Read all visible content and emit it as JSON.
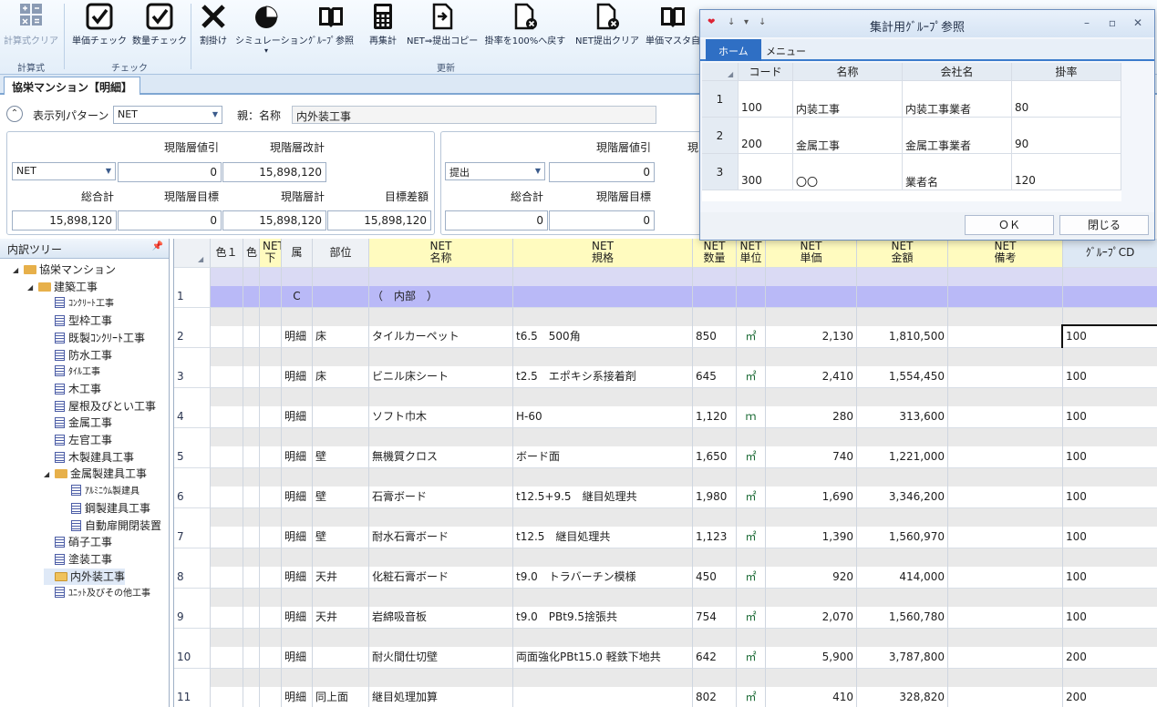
{
  "ribbon": {
    "buttons": [
      {
        "label": "計算式クリア",
        "icon": "calc-grid-icon",
        "gray": true
      },
      {
        "label": "単価チェック",
        "icon": "checkbox-icon"
      },
      {
        "label": "数量チェック",
        "icon": "checkbox-icon"
      },
      {
        "label": "割掛け",
        "icon": "x-mark-icon"
      },
      {
        "label": "シミュレーション",
        "icon": "pie-chart-icon"
      },
      {
        "label": "ｸﾞﾙｰﾌﾟ参照",
        "icon": "book-icon"
      },
      {
        "label": "再集計",
        "icon": "calculator-icon"
      },
      {
        "label": "NET⇒提出コピー",
        "icon": "doc-arrow-icon"
      },
      {
        "label": "掛率を100%へ戻す",
        "icon": "doc-clear-icon"
      },
      {
        "label": "NET提出クリア",
        "icon": "doc-clear-icon"
      },
      {
        "label": "単価マスタ自",
        "icon": "book-icon"
      }
    ],
    "groups": {
      "calc": "計算式",
      "check": "チェック",
      "update": "更新"
    }
  },
  "doc_tab": "協栄マンション【明細】",
  "filter": {
    "pattern_label": "表示列パターン",
    "pattern_value": "NET",
    "parent_label": "親：名称",
    "parent_value": "内外装工事"
  },
  "totals_left": {
    "combo": "NET",
    "labels": {
      "disc": "現階層値引",
      "revised": "現階層改計",
      "grand": "総合計",
      "target": "現階層目標",
      "sum": "現階層計",
      "diff": "目標差額"
    },
    "values": {
      "disc": "0",
      "revised": "15,898,120",
      "grand": "15,898,120",
      "target": "0",
      "sum": "15,898,120",
      "diff": "15,898,120"
    }
  },
  "totals_right": {
    "combo": "提出",
    "labels": {
      "disc": "現階層値引",
      "revised_partial": "現",
      "grand": "総合計",
      "target": "現階層目標"
    },
    "values": {
      "disc": "0",
      "grand": "0",
      "target": "0"
    }
  },
  "tree": {
    "title": "内訳ツリー",
    "pin": "ᵖ",
    "nodes": [
      {
        "label": "協栄マンション",
        "type": "folder",
        "level": 0,
        "exp": "◢"
      },
      {
        "label": "建築工事",
        "type": "folder",
        "level": 1,
        "exp": "◢"
      },
      {
        "label": "ｺﾝｸﾘｰﾄ工事",
        "type": "doc",
        "level": 2,
        "small": true
      },
      {
        "label": "型枠工事",
        "type": "doc",
        "level": 2
      },
      {
        "label": "既製ｺﾝｸﾘｰﾄ工事",
        "type": "doc",
        "level": 2
      },
      {
        "label": "防水工事",
        "type": "doc",
        "level": 2
      },
      {
        "label": "ﾀｲﾙ工事",
        "type": "doc",
        "level": 2,
        "small": true
      },
      {
        "label": "木工事",
        "type": "doc",
        "level": 2
      },
      {
        "label": "屋根及びとい工事",
        "type": "doc",
        "level": 2
      },
      {
        "label": "金属工事",
        "type": "doc",
        "level": 2
      },
      {
        "label": "左官工事",
        "type": "doc",
        "level": 2
      },
      {
        "label": "木製建具工事",
        "type": "doc",
        "level": 2
      },
      {
        "label": "金属製建具工事",
        "type": "folder",
        "level": 2,
        "exp": "◢"
      },
      {
        "label": "ｱﾙﾐﾆｳﾑ製建具",
        "type": "doc",
        "level": 3,
        "small": true
      },
      {
        "label": "鋼製建具工事",
        "type": "doc",
        "level": 3
      },
      {
        "label": "自動扉開閉装置",
        "type": "doc",
        "level": 3
      },
      {
        "label": "硝子工事",
        "type": "doc",
        "level": 2
      },
      {
        "label": "塗装工事",
        "type": "doc",
        "level": 2
      },
      {
        "label": "内外装工事",
        "type": "folder-open",
        "level": 2,
        "selected": true
      },
      {
        "label": "ﾕﾆｯﾄ及びその他工事",
        "type": "doc",
        "level": 2,
        "small": true
      }
    ]
  },
  "grid": {
    "headers": {
      "color1": "色１",
      "color": "色",
      "lower_top": "NET",
      "lower_bottom": "下",
      "attr": "属",
      "part": "部位",
      "name_top": "NET",
      "name_bottom": "名称",
      "spec_top": "NET",
      "spec_bottom": "規格",
      "qty_top": "NET",
      "qty_bottom": "数量",
      "unit_top": "NET",
      "unit_bottom": "単位",
      "price_top": "NET",
      "price_bottom": "単価",
      "amount_top": "NET",
      "amount_bottom": "金額",
      "note_top": "NET",
      "note_bottom": "備考",
      "groupcd": "ｸﾞﾙｰﾌﾟCD"
    },
    "section_row": {
      "no": "1",
      "attr": "C",
      "name": "（　内部　）"
    },
    "rows": [
      {
        "no": "2",
        "attr": "明細",
        "part": "床",
        "name": "タイルカーペット",
        "spec": "t6.5　500角",
        "qty": "850",
        "unit": "㎡",
        "price": "2,130",
        "amount": "1,810,500",
        "gcd": "100"
      },
      {
        "no": "3",
        "attr": "明細",
        "part": "床",
        "name": "ビニル床シート",
        "spec": "t2.5　エポキシ系接着剤",
        "qty": "645",
        "unit": "㎡",
        "price": "2,410",
        "amount": "1,554,450",
        "gcd": "100"
      },
      {
        "no": "4",
        "attr": "明細",
        "part": "",
        "name": "ソフト巾木",
        "spec": "H-60",
        "qty": "1,120",
        "unit": "ｍ",
        "price": "280",
        "amount": "313,600",
        "gcd": "100"
      },
      {
        "no": "5",
        "attr": "明細",
        "part": "壁",
        "name": "無機質クロス",
        "spec": "ボード面",
        "qty": "1,650",
        "unit": "㎡",
        "price": "740",
        "amount": "1,221,000",
        "gcd": "100"
      },
      {
        "no": "6",
        "attr": "明細",
        "part": "壁",
        "name": "石膏ボード",
        "spec": "t12.5+9.5　継目処理共",
        "qty": "1,980",
        "unit": "㎡",
        "price": "1,690",
        "amount": "3,346,200",
        "gcd": "100"
      },
      {
        "no": "7",
        "attr": "明細",
        "part": "壁",
        "name": "耐水石膏ボード",
        "spec": "t12.5　継目処理共",
        "qty": "1,123",
        "unit": "㎡",
        "price": "1,390",
        "amount": "1,560,970",
        "gcd": "100"
      },
      {
        "no": "8",
        "attr": "明細",
        "part": "天井",
        "name": "化粧石膏ボード",
        "spec": "t9.0　トラバーチン模様",
        "qty": "450",
        "unit": "㎡",
        "price": "920",
        "amount": "414,000",
        "gcd": "100"
      },
      {
        "no": "9",
        "attr": "明細",
        "part": "天井",
        "name": "岩綿吸音板",
        "spec": "t9.0　PBt9.5捨張共",
        "qty": "754",
        "unit": "㎡",
        "price": "2,070",
        "amount": "1,560,780",
        "gcd": "100"
      },
      {
        "no": "10",
        "attr": "明細",
        "part": "",
        "name": "耐火間仕切壁",
        "spec": "両面強化PBt15.0 軽鉄下地共",
        "qty": "642",
        "unit": "㎡",
        "price": "5,900",
        "amount": "3,787,800",
        "gcd": "200"
      },
      {
        "no": "11",
        "attr": "明細",
        "part": "同上面",
        "name": "継目処理加算",
        "spec": "",
        "qty": "802",
        "unit": "㎡",
        "price": "410",
        "amount": "328,820",
        "gcd": "200"
      }
    ]
  },
  "dialog": {
    "title": "集計用ｸﾞﾙｰﾌﾟ参照",
    "tabs": [
      "ホーム",
      "メニュー"
    ],
    "headers": [
      "コード",
      "名称",
      "会社名",
      "掛率"
    ],
    "rows": [
      {
        "no": "1",
        "code": "100",
        "name": "内装工事",
        "company": "内装工事業者",
        "rate": "80"
      },
      {
        "no": "2",
        "code": "200",
        "name": "金属工事",
        "company": "金属工事業者",
        "rate": "90"
      },
      {
        "no": "3",
        "code": "300",
        "name": "〇〇",
        "company": "業者名",
        "rate": "120"
      }
    ],
    "ok": "ＯＫ",
    "close": "閉じる"
  },
  "colors": {
    "accent": "#2f6fc4",
    "net_header": "#fffbbf",
    "section_row": "#b9b9f7",
    "spacer_row": "#e9e9e9"
  }
}
